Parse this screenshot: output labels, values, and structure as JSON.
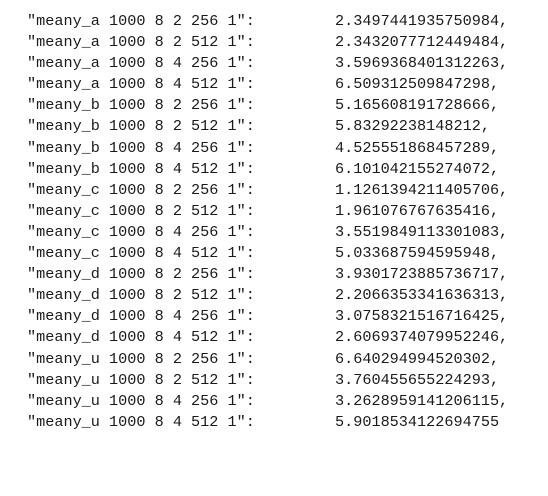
{
  "entries": [
    {
      "key": "\"meany_a 1000 8 2 256 1\":",
      "value": "2.3497441935750984,"
    },
    {
      "key": "\"meany_a 1000 8 2 512 1\":",
      "value": "2.3432077712449484,"
    },
    {
      "key": "\"meany_a 1000 8 4 256 1\":",
      "value": "3.5969368401312263,"
    },
    {
      "key": "\"meany_a 1000 8 4 512 1\":",
      "value": "6.509312509847298,"
    },
    {
      "key": "\"meany_b 1000 8 2 256 1\":",
      "value": "5.165608191728666,"
    },
    {
      "key": "\"meany_b 1000 8 2 512 1\":",
      "value": "5.83292238148212,"
    },
    {
      "key": "\"meany_b 1000 8 4 256 1\":",
      "value": "4.525551868457289,"
    },
    {
      "key": "\"meany_b 1000 8 4 512 1\":",
      "value": "6.101042155274072,"
    },
    {
      "key": "\"meany_c 1000 8 2 256 1\":",
      "value": "1.1261394211405706,"
    },
    {
      "key": "\"meany_c 1000 8 2 512 1\":",
      "value": "1.961076767635416,"
    },
    {
      "key": "\"meany_c 1000 8 4 256 1\":",
      "value": "3.5519849113301083,"
    },
    {
      "key": "\"meany_c 1000 8 4 512 1\":",
      "value": "5.033687594595948,"
    },
    {
      "key": "\"meany_d 1000 8 2 256 1\":",
      "value": "3.9301723885736717,"
    },
    {
      "key": "\"meany_d 1000 8 2 512 1\":",
      "value": "2.2066353341636313,"
    },
    {
      "key": "\"meany_d 1000 8 4 256 1\":",
      "value": "3.0758321516716425,"
    },
    {
      "key": "\"meany_d 1000 8 4 512 1\":",
      "value": "2.6069374079952246,"
    },
    {
      "key": "\"meany_u 1000 8 2 256 1\":",
      "value": "6.640294994520302,"
    },
    {
      "key": "\"meany_u 1000 8 2 512 1\":",
      "value": "3.760455655224293,"
    },
    {
      "key": "\"meany_u 1000 8 4 256 1\":",
      "value": "3.2628959141206115,"
    },
    {
      "key": "\"meany_u 1000 8 4 512 1\":",
      "value": "5.9018534122694755"
    }
  ]
}
